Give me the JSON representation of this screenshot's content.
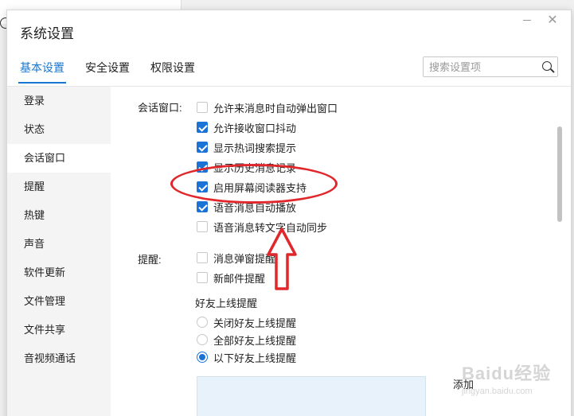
{
  "window": {
    "title": "系统设置",
    "minimize_glyph": "－",
    "close_glyph": "✕"
  },
  "tabs": [
    {
      "label": "基本设置",
      "active": true
    },
    {
      "label": "安全设置",
      "active": false
    },
    {
      "label": "权限设置",
      "active": false
    }
  ],
  "search": {
    "placeholder": "搜索设置项",
    "value": "",
    "icon": "search-icon"
  },
  "sidebar": {
    "items": [
      {
        "label": "登录",
        "active": false
      },
      {
        "label": "状态",
        "active": false
      },
      {
        "label": "会话窗口",
        "active": true
      },
      {
        "label": "提醒",
        "active": false
      },
      {
        "label": "热键",
        "active": false
      },
      {
        "label": "声音",
        "active": false
      },
      {
        "label": "软件更新",
        "active": false
      },
      {
        "label": "文件管理",
        "active": false
      },
      {
        "label": "文件共享",
        "active": false
      },
      {
        "label": "音视频通话",
        "active": false
      }
    ]
  },
  "session": {
    "label": "会话窗口:",
    "options": [
      {
        "label": "允许来消息时自动弹出窗口",
        "checked": false
      },
      {
        "label": "允许接收窗口抖动",
        "checked": true
      },
      {
        "label": "显示热词搜索提示",
        "checked": true
      },
      {
        "label": "显示历史消息记录",
        "checked": true
      },
      {
        "label": "启用屏幕阅读器支持",
        "checked": true
      },
      {
        "label": "语音消息自动播放",
        "checked": true
      },
      {
        "label": "语音消息转文字自动同步",
        "checked": false
      }
    ]
  },
  "reminder": {
    "label": "提醒:",
    "options": [
      {
        "label": "消息弹窗提醒",
        "checked": false
      },
      {
        "label": "新邮件提醒",
        "checked": false
      }
    ],
    "friend_online": {
      "label": "好友上线提醒",
      "options": [
        {
          "label": "关闭好友上线提醒",
          "selected": false
        },
        {
          "label": "全部好友上线提醒",
          "selected": false
        },
        {
          "label": "以下好友上线提醒",
          "selected": true
        }
      ],
      "add_label": "添加"
    }
  },
  "annotation": {
    "color": "#e0282c"
  },
  "watermark": {
    "brand": "Baidu经验",
    "url": "jingyan.baidu.com"
  },
  "colors": {
    "accent": "#1677d2",
    "checkbox": "#1b73d6"
  }
}
